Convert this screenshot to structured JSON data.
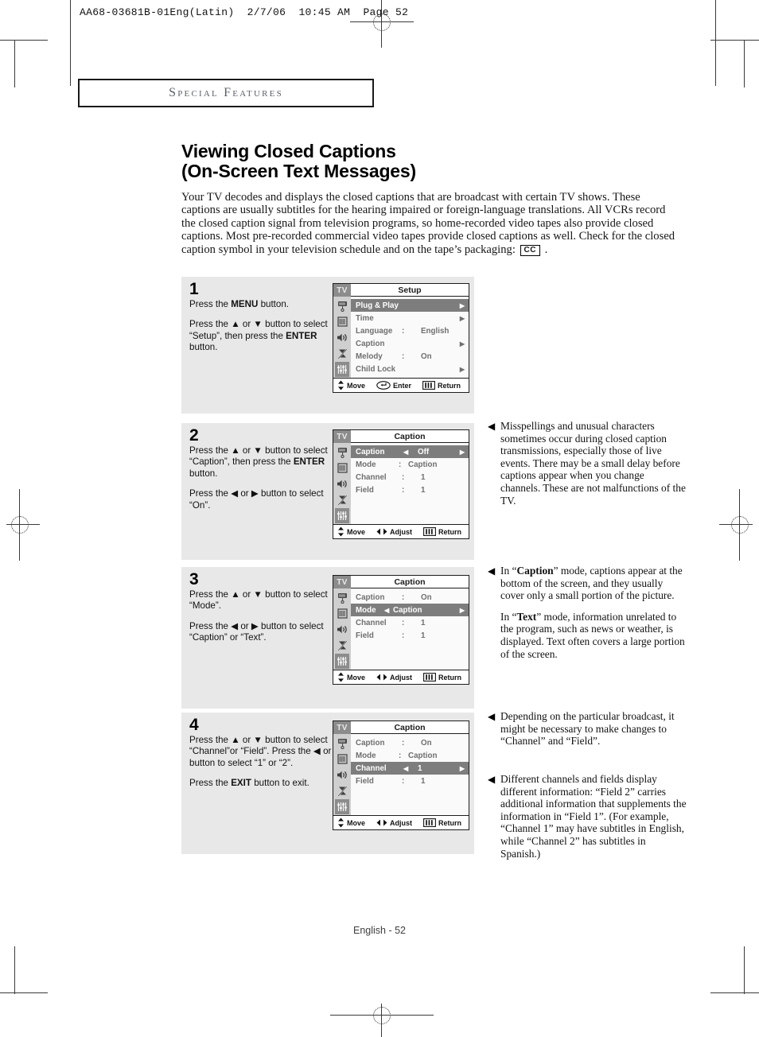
{
  "print_marks": {
    "job_line": "AA68-03681B-01Eng(Latin)  2/7/06  10:45 AM  Page 52"
  },
  "section_banner": {
    "label": "Special Features"
  },
  "title": {
    "line1": "Viewing Closed Captions",
    "line2": "(On-Screen Text Messages)"
  },
  "intro": {
    "text_before": "Your TV decodes and displays the closed captions that are broadcast with certain TV shows. These captions are usually subtitles for the hearing impaired or foreign-language translations. All VCRs record the closed caption signal from television programs, so home-recorded video tapes also provide closed captions. Most pre-recorded commercial video tapes provide closed captions as well. Check for the closed caption symbol in your television schedule and on the tape’s packaging:",
    "cc_symbol": "CC",
    "text_after": "."
  },
  "steps": [
    {
      "number": "1",
      "paragraphs": [
        {
          "parts": [
            {
              "t": "Press the ",
              "b": false
            },
            {
              "t": "MENU",
              "b": true
            },
            {
              "t": " button.",
              "b": false
            }
          ]
        },
        {
          "parts": [
            {
              "t": "Press the ▲ or ▼ button to select “Setup”, then press the ",
              "b": false
            },
            {
              "t": "ENTER",
              "b": true
            },
            {
              "t": " button.",
              "b": false
            }
          ]
        }
      ],
      "osd": {
        "tv_tab": "TV",
        "title": "Setup",
        "rail_icons": [
          "antenna-icon",
          "picture-icon",
          "speaker-icon",
          "no-signal-icon",
          "setup-sliders-icon"
        ],
        "rail_active_index": 4,
        "rows": [
          {
            "label": "Plug & Play",
            "colon": "",
            "value": "",
            "selected": true,
            "right_arrow": true,
            "carets": false
          },
          {
            "label": "Time",
            "colon": "",
            "value": "",
            "selected": false,
            "right_arrow": true,
            "carets": false
          },
          {
            "label": "Language",
            "colon": ":",
            "value": "English",
            "selected": false,
            "right_arrow": false,
            "carets": false
          },
          {
            "label": "Caption",
            "colon": "",
            "value": "",
            "selected": false,
            "right_arrow": true,
            "carets": false
          },
          {
            "label": "Melody",
            "colon": ":",
            "value": "On",
            "selected": false,
            "right_arrow": false,
            "carets": false
          },
          {
            "label": "Child Lock",
            "colon": "",
            "value": "",
            "selected": false,
            "right_arrow": true,
            "carets": false
          }
        ],
        "footer": [
          {
            "icon": "updown-arrows-icon",
            "label": "Move"
          },
          {
            "icon": "enter-oval-icon",
            "label": "Enter"
          },
          {
            "icon": "return-bars-icon",
            "label": "Return"
          }
        ]
      }
    },
    {
      "number": "2",
      "paragraphs": [
        {
          "parts": [
            {
              "t": "Press the ▲ or ▼ button to select “Caption”, then press the ",
              "b": false
            },
            {
              "t": "ENTER",
              "b": true
            },
            {
              "t": " button.",
              "b": false
            }
          ]
        },
        {
          "parts": [
            {
              "t": "Press the ◀ or ▶ button to select “On”.",
              "b": false
            }
          ]
        }
      ],
      "osd": {
        "tv_tab": "TV",
        "title": "Caption",
        "rail_icons": [
          "antenna-icon",
          "picture-icon",
          "speaker-icon",
          "no-signal-icon",
          "setup-sliders-icon"
        ],
        "rail_active_index": 4,
        "rows": [
          {
            "label": "Caption",
            "colon": "",
            "value": "Off",
            "selected": true,
            "right_arrow": false,
            "carets": true
          },
          {
            "label": "Mode",
            "colon": ":",
            "value": "Caption",
            "selected": false,
            "right_arrow": false,
            "carets": false,
            "mode_style": true
          },
          {
            "label": "Channel",
            "colon": ":",
            "value": "1",
            "selected": false,
            "right_arrow": false,
            "carets": false
          },
          {
            "label": "Field",
            "colon": ":",
            "value": "1",
            "selected": false,
            "right_arrow": false,
            "carets": false
          }
        ],
        "footer": [
          {
            "icon": "updown-arrows-icon",
            "label": "Move"
          },
          {
            "icon": "leftright-arrows-icon",
            "label": "Adjust"
          },
          {
            "icon": "return-bars-icon",
            "label": "Return"
          }
        ]
      }
    },
    {
      "number": "3",
      "paragraphs": [
        {
          "parts": [
            {
              "t": "Press the ▲ or ▼ button to select “Mode”.",
              "b": false
            }
          ]
        },
        {
          "parts": [
            {
              "t": "Press the ◀ or ▶ button to select “Caption” or “Text”.",
              "b": false
            }
          ]
        }
      ],
      "osd": {
        "tv_tab": "TV",
        "title": "Caption",
        "rail_icons": [
          "antenna-icon",
          "picture-icon",
          "speaker-icon",
          "no-signal-icon",
          "setup-sliders-icon"
        ],
        "rail_active_index": 4,
        "rows": [
          {
            "label": "Caption",
            "colon": ":",
            "value": "On",
            "selected": false,
            "right_arrow": false,
            "carets": false
          },
          {
            "label": "Mode",
            "colon": "",
            "value": "Caption",
            "selected": true,
            "right_arrow": false,
            "carets": true,
            "caret_value_left": true
          },
          {
            "label": "Channel",
            "colon": ":",
            "value": "1",
            "selected": false,
            "right_arrow": false,
            "carets": false
          },
          {
            "label": "Field",
            "colon": ":",
            "value": "1",
            "selected": false,
            "right_arrow": false,
            "carets": false
          }
        ],
        "footer": [
          {
            "icon": "updown-arrows-icon",
            "label": "Move"
          },
          {
            "icon": "leftright-arrows-icon",
            "label": "Adjust"
          },
          {
            "icon": "return-bars-icon",
            "label": "Return"
          }
        ]
      }
    },
    {
      "number": "4",
      "paragraphs": [
        {
          "parts": [
            {
              "t": "Press the ▲ or ▼ button to select “Channel”or “Field”. Press the ◀ or ▶ button to select “1” or “2”.",
              "b": false
            }
          ]
        },
        {
          "parts": [
            {
              "t": "Press the ",
              "b": false
            },
            {
              "t": "EXIT",
              "b": true
            },
            {
              "t": " button to exit.",
              "b": false
            }
          ]
        }
      ],
      "osd": {
        "tv_tab": "TV",
        "title": "Caption",
        "rail_icons": [
          "antenna-icon",
          "picture-icon",
          "speaker-icon",
          "no-signal-icon",
          "setup-sliders-icon"
        ],
        "rail_active_index": 4,
        "rows": [
          {
            "label": "Caption",
            "colon": ":",
            "value": "On",
            "selected": false,
            "right_arrow": false,
            "carets": false
          },
          {
            "label": "Mode",
            "colon": ":",
            "value": "Caption",
            "selected": false,
            "right_arrow": false,
            "carets": false,
            "mode_style": true
          },
          {
            "label": "Channel",
            "colon": "",
            "value": "1",
            "selected": true,
            "right_arrow": false,
            "carets": true
          },
          {
            "label": "Field",
            "colon": ":",
            "value": "1",
            "selected": false,
            "right_arrow": false,
            "carets": false
          }
        ],
        "footer": [
          {
            "icon": "updown-arrows-icon",
            "label": "Move"
          },
          {
            "icon": "leftright-arrows-icon",
            "label": "Adjust"
          },
          {
            "icon": "return-bars-icon",
            "label": "Return"
          }
        ]
      }
    }
  ],
  "notes": [
    {
      "bullet": "◀",
      "paragraphs": [
        {
          "parts": [
            {
              "t": "Misspellings and unusual characters sometimes occur during closed caption transmissions, especially those of live events. There may be a small delay before captions appear when you change channels. These are not malfunctions of the TV.",
              "b": false
            }
          ]
        }
      ]
    },
    {
      "bullet": "◀",
      "paragraphs": [
        {
          "parts": [
            {
              "t": "In “",
              "b": false
            },
            {
              "t": "Caption",
              "b": true
            },
            {
              "t": "” mode, captions appear at the bottom of the screen, and they usually cover only a small portion of the picture.",
              "b": false
            }
          ]
        },
        {
          "parts": [
            {
              "t": "In “",
              "b": false
            },
            {
              "t": "Text",
              "b": true
            },
            {
              "t": "” mode, information unrelated to the program, such as news or weather, is displayed. Text often covers a large portion of the screen.",
              "b": false
            }
          ]
        }
      ]
    },
    {
      "bullet": "◀",
      "paragraphs": [
        {
          "parts": [
            {
              "t": "Depending on the particular broadcast, it might be necessary to make changes to “Channel” and “Field”.",
              "b": false
            }
          ]
        }
      ]
    },
    {
      "bullet": "◀",
      "paragraphs": [
        {
          "parts": [
            {
              "t": "Different channels and fields display different information: “Field 2” carries additional information that supplements the information in “Field 1”. (For example, “Channel 1” may have subtitles in English, while “Channel 2” has subtitles in Spanish.)",
              "b": false
            }
          ]
        }
      ]
    }
  ],
  "footer": {
    "page_label": "English - 52"
  },
  "colors": {
    "panel_bg": "#e8e8e8",
    "osd_selected": "#7d7d7d",
    "osd_rail": "#cfcfcf",
    "osd_tab": "#8c8c8c",
    "osd_text": "#6f6f6f"
  }
}
